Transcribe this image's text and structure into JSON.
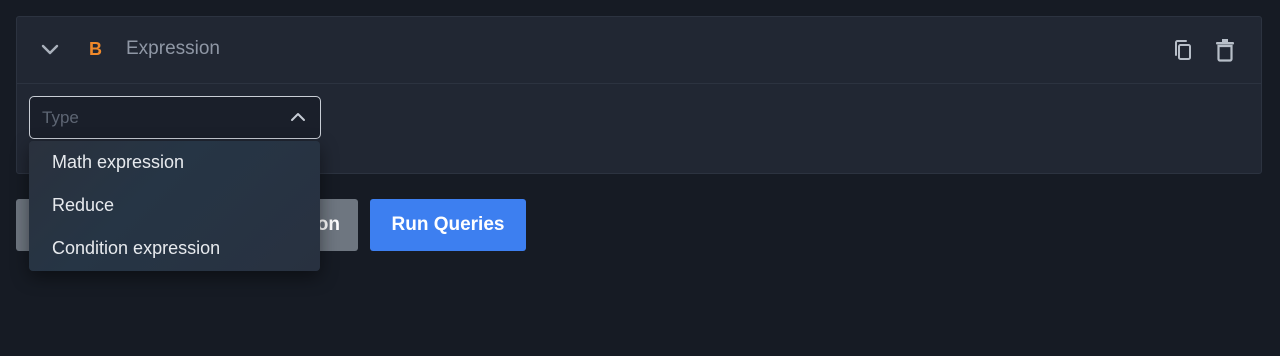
{
  "query": {
    "ref_id": "B",
    "type_label": "Expression"
  },
  "type_select": {
    "placeholder": "Type",
    "value": ""
  },
  "dropdown": {
    "options": [
      "Math expression",
      "Reduce",
      "Condition expression"
    ]
  },
  "buttons": {
    "add_expression_visible": "on",
    "run_queries": "Run Queries"
  },
  "colors": {
    "ref_id": "#f0892a",
    "primary_button": "#3d7ff0",
    "background": "#161b24"
  },
  "icons": {
    "collapse": "chevron-down-icon",
    "duplicate": "copy-icon",
    "delete": "trash-icon",
    "select_toggle": "chevron-up-icon"
  }
}
